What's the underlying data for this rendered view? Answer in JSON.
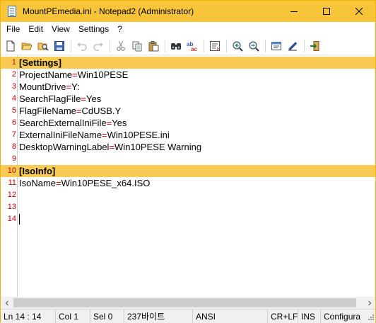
{
  "window": {
    "title": "MountPEmedia.ini - Notepad2 (Administrator)",
    "accent_color": "#f8c53a"
  },
  "title_buttons": [
    "minimize-icon",
    "maximize-icon",
    "close-icon"
  ],
  "menu": [
    "File",
    "Edit",
    "View",
    "Settings",
    "?"
  ],
  "toolbar": {
    "icons": [
      "new-icon",
      "open-icon",
      "browse-icon",
      "save-icon",
      "undo-icon",
      "redo-icon",
      "cut-icon",
      "copy-icon",
      "paste-icon",
      "find-icon",
      "replace-icon",
      "wordwrap-icon",
      "zoom-in-icon",
      "zoom-out-icon",
      "scheme-icon",
      "customize-icon",
      "exit-icon"
    ]
  },
  "editor": {
    "line_numbers": [
      "1",
      "2",
      "3",
      "4",
      "5",
      "6",
      "7",
      "8",
      "9",
      "10",
      "11",
      "12",
      "13",
      "14"
    ],
    "lines": [
      {
        "key": "[Settings]",
        "eq": "",
        "value": "",
        "section": true
      },
      {
        "key": "ProjectName",
        "eq": "=",
        "value": "Win10PESE",
        "section": false
      },
      {
        "key": "MountDrive",
        "eq": "=",
        "value": "Y:",
        "section": false
      },
      {
        "key": "SearchFlagFile",
        "eq": "=",
        "value": "Yes",
        "section": false
      },
      {
        "key": "FlagFileName",
        "eq": "=",
        "value": "CdUSB.Y",
        "section": false
      },
      {
        "key": "SearchExternalIniFile",
        "eq": "=",
        "value": "Yes",
        "section": false
      },
      {
        "key": "ExternalIniFileName",
        "eq": "=",
        "value": "Win10PESE.ini",
        "section": false
      },
      {
        "key": "DesktopWarningLabel",
        "eq": "=",
        "value": "Win10PESE Warning",
        "section": false
      },
      {
        "key": "",
        "eq": "",
        "value": "",
        "section": false
      },
      {
        "key": "[IsoInfo]",
        "eq": "",
        "value": "",
        "section": true
      },
      {
        "key": "IsoName",
        "eq": "=",
        "value": "Win10PESE_x64.ISO",
        "section": false
      },
      {
        "key": "",
        "eq": "",
        "value": "",
        "section": false
      },
      {
        "key": "",
        "eq": "",
        "value": "",
        "section": false
      },
      {
        "key": "",
        "eq": "",
        "value": "",
        "section": false
      }
    ]
  },
  "status": {
    "position": "Ln 14 : 14",
    "column": "Col 1",
    "selection": "Sel 0",
    "size": "237바이트",
    "encoding": "ANSI",
    "line_ending": "CR+LF",
    "mode": "INS",
    "scheme": "Configura"
  }
}
